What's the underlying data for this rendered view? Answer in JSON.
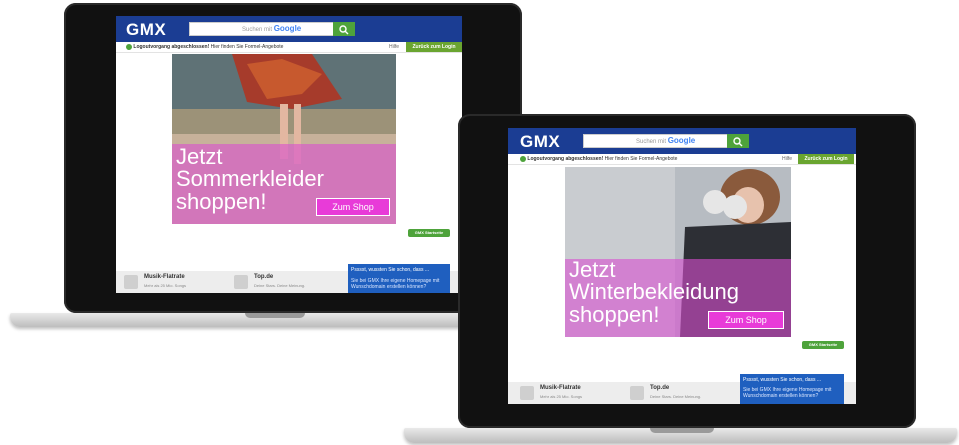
{
  "colors": {
    "header": "#1b3d93",
    "green": "#4ea33b",
    "shop": "#e83bd8",
    "popup": "#1f5fbf"
  },
  "common": {
    "logo": "GMX",
    "search_placeholder": "Suchen mit",
    "search_brand": "Google",
    "search_icon": "search-icon",
    "status_bold": "Logoutvorgang abgeschlossen!",
    "status_text": " Hier finden Sie Formel-Angebote",
    "hilfe": "Hilfe",
    "back_login": "Zurück zum Login",
    "start_button": "GMX Startseite",
    "shop_button": "Zum Shop",
    "footer_items": [
      {
        "title": "Musik-Flatrate",
        "sub": "Mehr als 25 Mio. Songs",
        "icon": "cloud-icon"
      },
      {
        "title": "Top.de",
        "sub": "Deine Stars. Deine Meinung.",
        "icon": "tag-icon"
      }
    ],
    "popup_title": "Psssst, wussten Sie schon, dass ...",
    "popup_text": "Sie bei GMX Ihre eigene Homepage mit Wunschdomain erstellen können?"
  },
  "laptop1": {
    "ad_lines": [
      "Jetzt",
      "Sommerkleider",
      "shoppen!"
    ]
  },
  "laptop2": {
    "ad_lines": [
      "Jetzt",
      "Winterbekleidung",
      "shoppen!"
    ]
  }
}
